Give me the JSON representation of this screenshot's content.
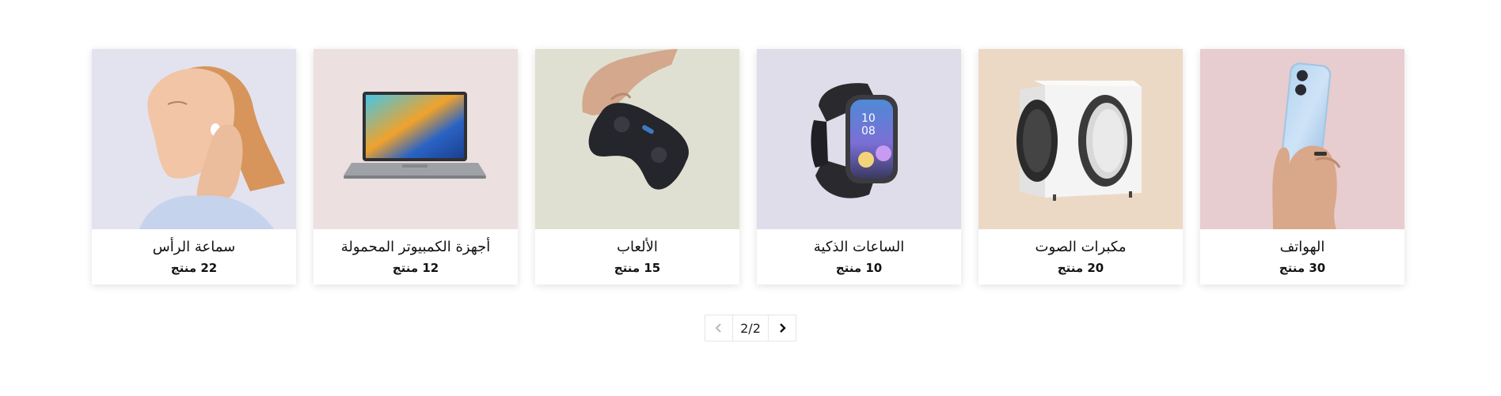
{
  "categories": [
    {
      "title": "الهواتف",
      "count": "30 منتج",
      "bg": "#e7ccd0",
      "icon": "phone-in-hand-image"
    },
    {
      "title": "مكبرات الصوت",
      "count": "20 منتج",
      "bg": "#ecd9c5",
      "icon": "speaker-image"
    },
    {
      "title": "الساعات الذكية",
      "count": "10 منتج",
      "bg": "#dedde9",
      "icon": "smartwatch-image"
    },
    {
      "title": "الألعاب",
      "count": "15 منتج",
      "bg": "#e0e0d2",
      "icon": "gamepad-image"
    },
    {
      "title": "أجهزة الكمبيوتر المحمولة",
      "count": "12 منتج",
      "bg": "#ece0e0",
      "icon": "laptop-image"
    },
    {
      "title": "سماعة الرأس",
      "count": "22 منتج",
      "bg": "#e2e3ef",
      "icon": "woman-with-earbuds-image"
    }
  ],
  "pagination": {
    "indicator": "2/2",
    "prev_icon": "chevron-left-icon",
    "next_icon": "chevron-right-icon"
  }
}
